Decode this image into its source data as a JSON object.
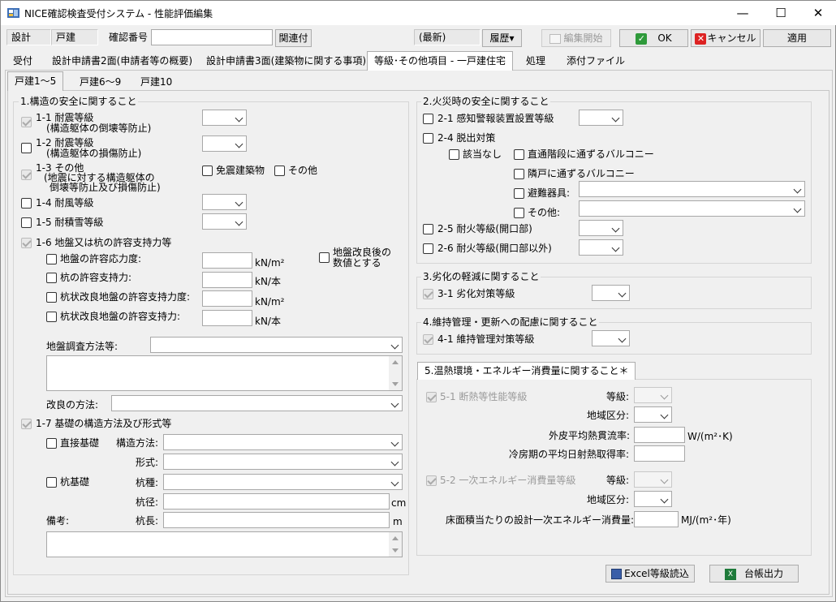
{
  "window": {
    "title": "NICE確認検査受付システム - 性能評価編集",
    "minimize": "—",
    "maximize": "☐",
    "close": "✕"
  },
  "header": {
    "field1": "設計",
    "field2": "戸建",
    "confirm_no_label": "確認番号",
    "confirm_no_value": "",
    "related_btn": "関連付",
    "latest": "(最新)",
    "history_btn": "履歴▾",
    "edit_start_btn": "編集開始",
    "ok_btn": "OK",
    "cancel_btn": "キャンセル",
    "apply_btn": "適用"
  },
  "tabs": [
    "受付",
    "設計申請書2面(申請者等の概要)",
    "設計申請書3面(建築物に関する事項)",
    "等級･その他項目 - 一戸建住宅",
    "処理",
    "添付ファイル"
  ],
  "subtabs": [
    "戸建1～5",
    "戸建6～9",
    "戸建10"
  ],
  "s1": {
    "title": "1.構造の安全に関すること",
    "i1a": "1-1 耐震等級",
    "i1b": "(構造躯体の倒壊等防止)",
    "i2a": "1-2 耐震等級",
    "i2b": "(構造躯体の損傷防止)",
    "i3a": "1-3 その他",
    "i3b": "(地震に対する構造躯体の",
    "i3c": "倒壊等防止及び損傷防止)",
    "menshin": "免震建築物",
    "sonota": "その他",
    "i4": "1-4 耐風等級",
    "i5": "1-5 耐積雪等級",
    "i6": "1-6 地盤又は杭の許容支持力等",
    "kairyo_a": "地盤改良後の",
    "kairyo_b": "数値とする",
    "r1": "地盤の許容応力度:",
    "r2": "杭の許容支持力:",
    "r3": "杭状改良地盤の許容支持力度:",
    "r4": "杭状改良地盤の許容支持力:",
    "u1": "kN/m²",
    "u2": "kN/本",
    "u3": "kN/m²",
    "u4": "kN/本",
    "chosa": "地盤調査方法等:",
    "kairyo_method": "改良の方法:",
    "i7": "1-7 基礎の構造方法及び形式等",
    "chokusetsu": "直接基礎",
    "kozo": "構造方法:",
    "keishiki": "形式:",
    "kui": "杭基礎",
    "kuisyu": "杭種:",
    "kuikei": "杭径:",
    "cm": "cm",
    "biko": "備考:",
    "kuicho": "杭長:",
    "m": "m"
  },
  "s2": {
    "title": "2.火災時の安全に関すること",
    "i1": "2-1 感知警報装置設置等級",
    "i4": "2-4 脱出対策",
    "gaito": "該当なし",
    "c1": "直通階段に通ずるバルコニー",
    "c2": "隣戸に通ずるバルコニー",
    "c3": "避難器具:",
    "c4": "その他:",
    "i5": "2-5 耐火等級(開口部)",
    "i6": "2-6 耐火等級(開口部以外)"
  },
  "s3": {
    "title": "3.劣化の軽減に関すること",
    "i1": "3-1 劣化対策等級"
  },
  "s4": {
    "title": "4.維持管理・更新への配慮に関すること",
    "i1": "4-1 維持管理対策等級"
  },
  "s5": {
    "title": "5.温熱環境・エネルギー消費量に関すること＊",
    "i1": "5-1 断熱等性能等級",
    "tokyu": "等級:",
    "chiiki": "地域区分:",
    "gaihi": "外皮平均熱貫流率:",
    "gaihi_u": "W/(m²･K)",
    "reibo": "冷房期の平均日射熱取得率:",
    "i2": "5-2 一次エネルギー消費量等級",
    "tokyu2": "等級:",
    "chiiki2": "地域区分:",
    "yuka": "床面積当たりの設計一次エネルギー消費量:",
    "yuka_u": "MJ/(m²･年)"
  },
  "footer": {
    "excel": "Excel等級読込",
    "daicho": "台帳出力"
  }
}
